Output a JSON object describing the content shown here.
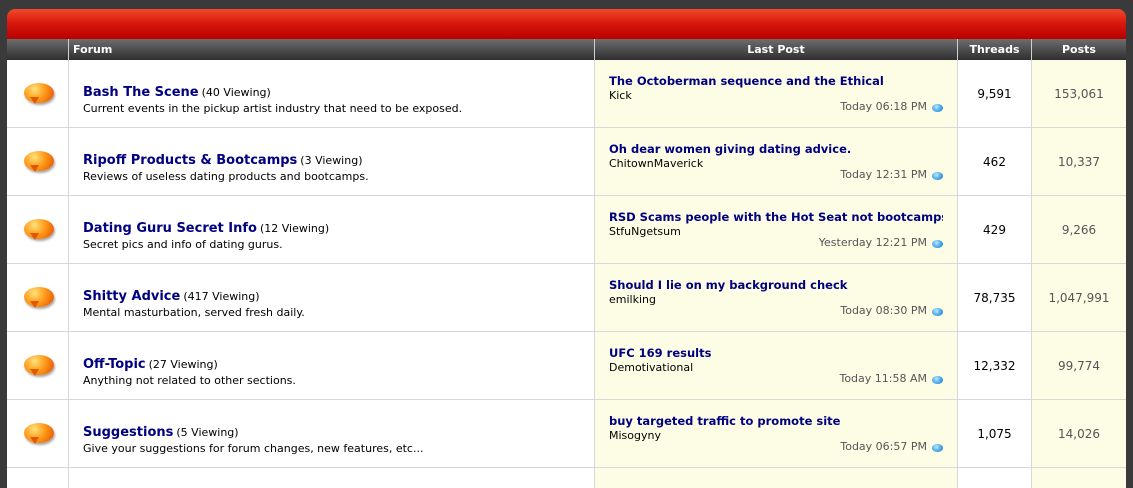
{
  "header": {
    "forum": "Forum",
    "last_post": "Last Post",
    "threads": "Threads",
    "posts": "Posts"
  },
  "forums": [
    {
      "title": "Bash The Scene",
      "viewing": "(40 Viewing)",
      "description": "Current events in the pickup artist industry that need to be exposed.",
      "last_title": "The Octoberman sequence and the Ethical",
      "last_user": "Kick",
      "last_time": "Today 06:18 PM",
      "threads": "9,591",
      "posts": "153,061"
    },
    {
      "title": "Ripoff Products & Bootcamps",
      "viewing": "(3 Viewing)",
      "description": "Reviews of useless dating products and bootcamps.",
      "last_title": "Oh dear women giving dating advice.",
      "last_user": "ChitownMaverick",
      "last_time": "Today 12:31 PM",
      "threads": "462",
      "posts": "10,337"
    },
    {
      "title": "Dating Guru Secret Info",
      "viewing": "(12 Viewing)",
      "description": "Secret pics and info of dating gurus.",
      "last_title": "RSD Scams people with the Hot Seat not bootcamps",
      "last_user": "StfuNgetsum",
      "last_time": "Yesterday 12:21 PM",
      "threads": "429",
      "posts": "9,266"
    },
    {
      "title": "Shitty Advice",
      "viewing": "(417 Viewing)",
      "description": "Mental masturbation, served fresh daily.",
      "last_title": "Should I lie on my background check",
      "last_user": "emilking",
      "last_time": "Today 08:30 PM",
      "threads": "78,735",
      "posts": "1,047,991"
    },
    {
      "title": "Off-Topic",
      "viewing": "(27 Viewing)",
      "description": "Anything not related to other sections.",
      "last_title": "UFC 169 results",
      "last_user": "Demotivational",
      "last_time": "Today 11:58 AM",
      "threads": "12,332",
      "posts": "99,774"
    },
    {
      "title": "Suggestions",
      "viewing": "(5 Viewing)",
      "description": "Give your suggestions for forum changes, new features, etc...",
      "last_title": "buy targeted traffic to promote site",
      "last_user": "Misogyny",
      "last_time": "Today 06:57 PM",
      "threads": "1,075",
      "posts": "14,026"
    }
  ]
}
